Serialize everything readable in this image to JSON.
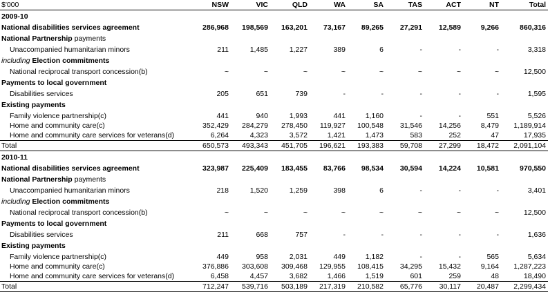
{
  "header": {
    "unit": "$'000",
    "cols": [
      "NSW",
      "VIC",
      "QLD",
      "WA",
      "SA",
      "TAS",
      "ACT",
      "NT",
      "Total"
    ]
  },
  "y1": {
    "year": "2009-10",
    "nda": {
      "label": "National disabilities services agreement",
      "v": [
        "286,968",
        "198,569",
        "163,201",
        "73,167",
        "89,265",
        "27,291",
        "12,589",
        "9,266",
        "860,316"
      ]
    },
    "np_head": {
      "bold": "National Partnership",
      "rest": " payments"
    },
    "uhm": {
      "label": "Unaccompanied humanitarian minors",
      "v": [
        "211",
        "1,485",
        "1,227",
        "389",
        "6",
        "-",
        "-",
        "-",
        "3,318"
      ]
    },
    "ec_head": {
      "ital": "including",
      "bold": " Election commitments"
    },
    "nrtc": {
      "label": "National reciprocal transport concession(b)",
      "v": [
        "~",
        "~",
        "~",
        "~",
        "~",
        "~",
        "~",
        "~",
        "12,500"
      ]
    },
    "plg_head": "Payments to local government",
    "ds": {
      "label": "Disabilities services",
      "v": [
        "205",
        "651",
        "739",
        "-",
        "-",
        "-",
        "-",
        "-",
        "1,595"
      ]
    },
    "ep_head": "Existing payments",
    "fvp": {
      "label": "Family violence partnership(c)",
      "v": [
        "441",
        "940",
        "1,993",
        "441",
        "1,160",
        "-",
        "-",
        "551",
        "5,526"
      ]
    },
    "hcc": {
      "label": "Home and community care(c)",
      "v": [
        "352,429",
        "284,279",
        "278,450",
        "119,927",
        "100,548",
        "31,546",
        "14,256",
        "8,479",
        "1,189,914"
      ]
    },
    "hccv": {
      "label": "Home and community care services for veterans(d)",
      "v": [
        "6,264",
        "4,323",
        "3,572",
        "1,421",
        "1,473",
        "583",
        "252",
        "47",
        "17,935"
      ]
    },
    "total": {
      "label": "Total",
      "v": [
        "650,573",
        "493,343",
        "451,705",
        "196,621",
        "193,383",
        "59,708",
        "27,299",
        "18,472",
        "2,091,104"
      ]
    }
  },
  "y2": {
    "year": "2010-11",
    "nda": {
      "label": "National disabilities services agreement",
      "v": [
        "323,987",
        "225,409",
        "183,455",
        "83,766",
        "98,534",
        "30,594",
        "14,224",
        "10,581",
        "970,550"
      ]
    },
    "np_head": {
      "bold": "National Partnership",
      "rest": " payments"
    },
    "uhm": {
      "label": "Unaccompanied humanitarian minors",
      "v": [
        "218",
        "1,520",
        "1,259",
        "398",
        "6",
        "-",
        "-",
        "-",
        "3,401"
      ]
    },
    "ec_head": {
      "ital": "including",
      "bold": " Election commitments"
    },
    "nrtc": {
      "label": "National reciprocal transport concession(b)",
      "v": [
        "~",
        "~",
        "~",
        "~",
        "~",
        "~",
        "~",
        "~",
        "12,500"
      ]
    },
    "plg_head": "Payments to local government",
    "ds": {
      "label": "Disabilities services",
      "v": [
        "211",
        "668",
        "757",
        "-",
        "-",
        "-",
        "-",
        "-",
        "1,636"
      ]
    },
    "ep_head": "Existing payments",
    "fvp": {
      "label": "Family violence partnership(c)",
      "v": [
        "449",
        "958",
        "2,031",
        "449",
        "1,182",
        "-",
        "-",
        "565",
        "5,634"
      ]
    },
    "hcc": {
      "label": "Home and community care(c)",
      "v": [
        "376,886",
        "303,608",
        "309,468",
        "129,955",
        "108,415",
        "34,295",
        "15,432",
        "9,164",
        "1,287,223"
      ]
    },
    "hccv": {
      "label": "Home and community care services for veterans(d)",
      "v": [
        "6,458",
        "4,457",
        "3,682",
        "1,466",
        "1,519",
        "601",
        "259",
        "48",
        "18,490"
      ]
    },
    "total": {
      "label": "Total",
      "v": [
        "712,247",
        "539,716",
        "503,189",
        "217,319",
        "210,582",
        "65,776",
        "30,117",
        "20,487",
        "2,299,434"
      ]
    }
  }
}
